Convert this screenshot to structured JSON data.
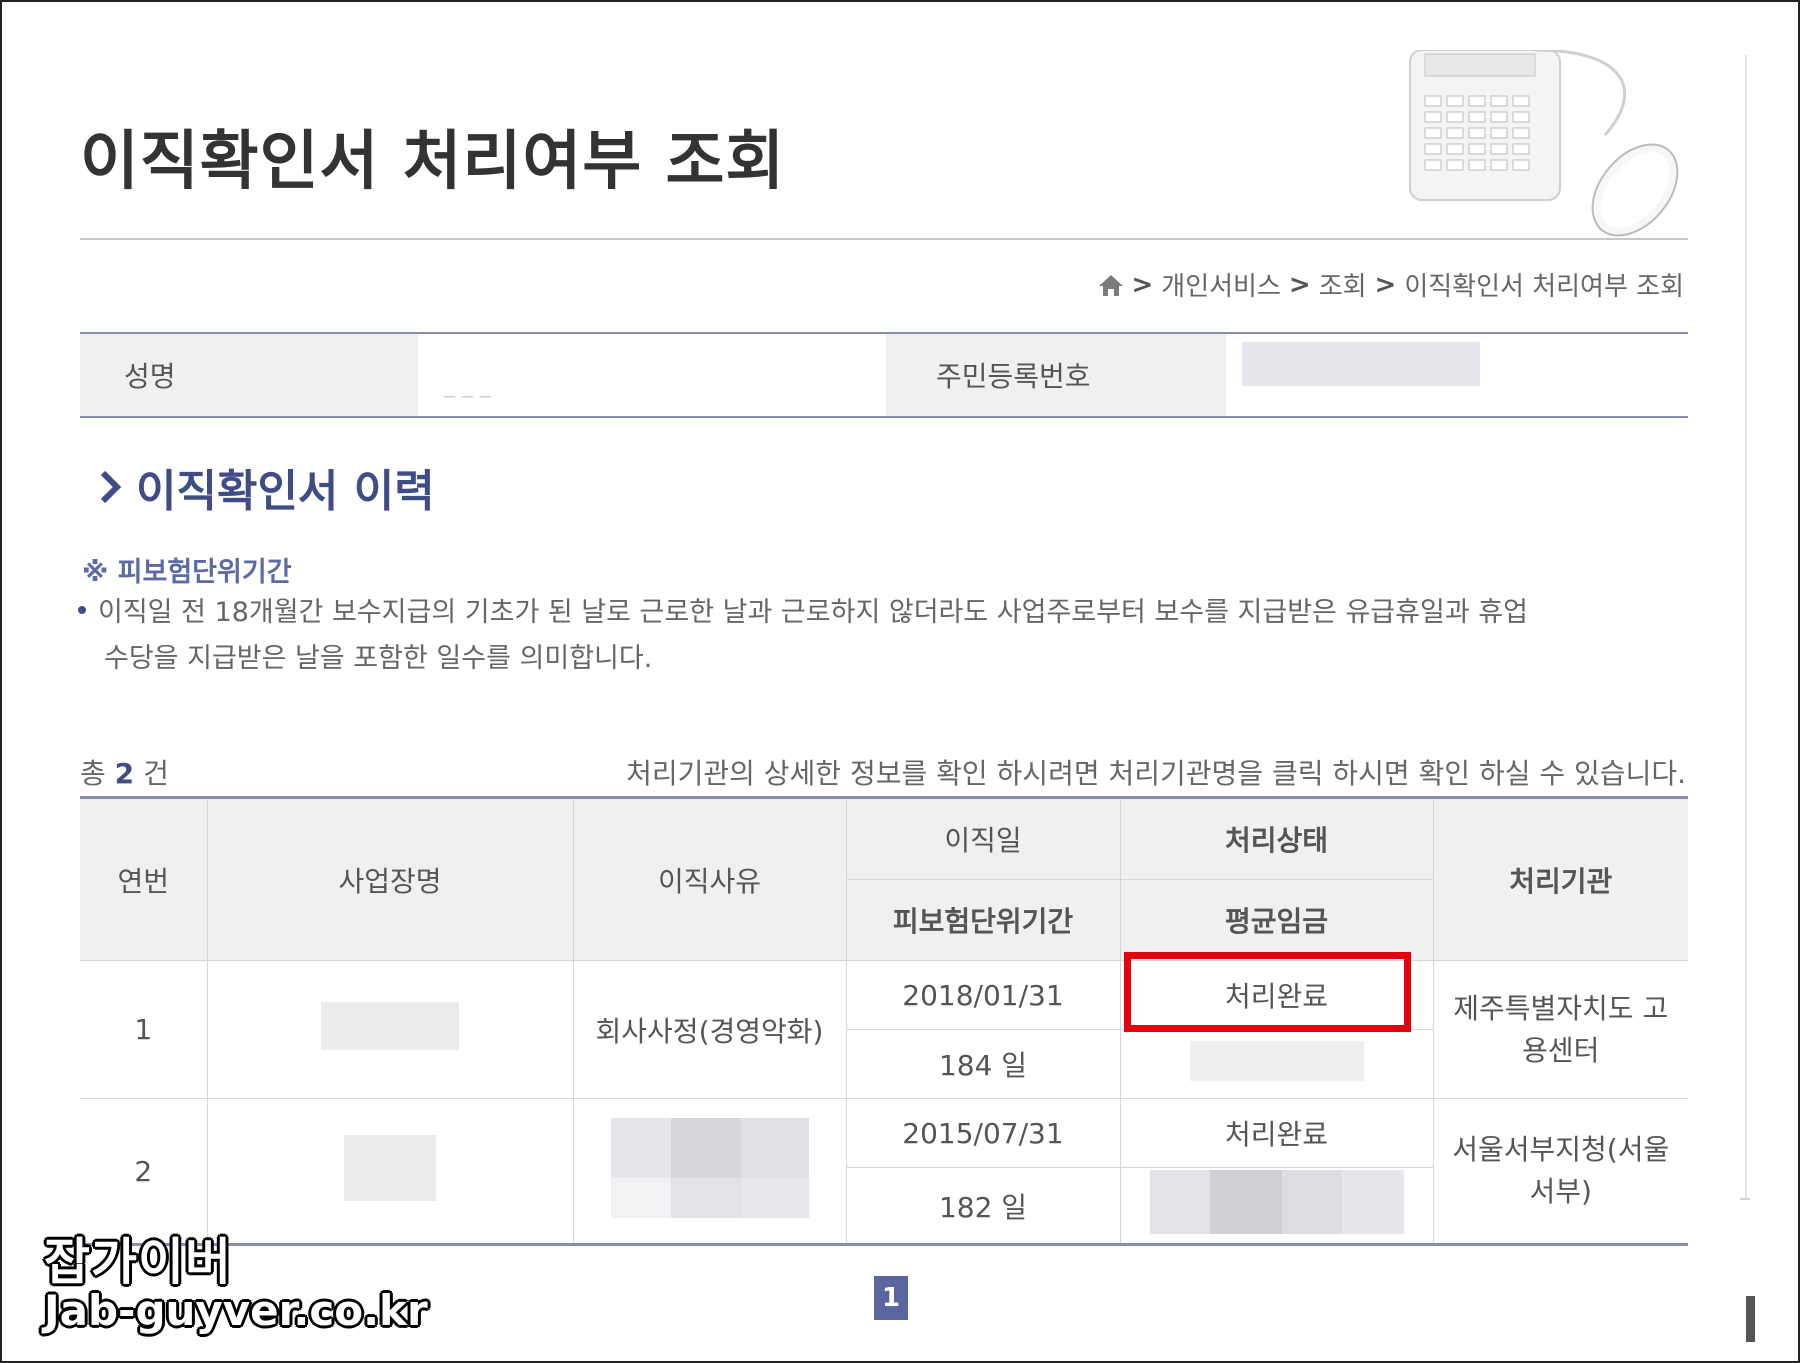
{
  "page": {
    "title": "이직확인서 처리여부 조회"
  },
  "breadcrumb": {
    "home_icon": "home-icon",
    "separator": ">",
    "items": [
      "개인서비스",
      "조회",
      "이직확인서 처리여부 조회"
    ]
  },
  "info": {
    "name_label": "성명",
    "name_value": "_ _ _",
    "rrn_label": "주민등록번호"
  },
  "section": {
    "title": "이직확인서 이력",
    "note_heading": "※ 피보험단위기간",
    "note_line1": "이직일 전 18개월간 보수지급의 기초가 된 날로 근로한 날과 근로하지 않더라도 사업주로부터 보수를 지급받은 유급휴일과 휴업",
    "note_line2": "수당을 지급받은 날을 포함한 일수를 의미합니다."
  },
  "summary": {
    "prefix": "총",
    "count": "2",
    "suffix": "건",
    "help": "처리기관의 상세한 정보를 확인 하시려면 처리기관명을 클릭 하시면 확인 하실 수 있습니다."
  },
  "table": {
    "headers": {
      "seq": "연번",
      "workplace": "사업장명",
      "reason": "이직사유",
      "leave_date": "이직일",
      "status": "처리상태",
      "agency": "처리기관",
      "insured_period": "피보험단위기간",
      "avg_wage": "평균임금"
    },
    "rows": [
      {
        "seq": "1",
        "reason": "회사사정(경영악화)",
        "leave_date": "2018/01/31",
        "status": "처리완료",
        "insured_period": "184 일",
        "agency": "제주특별자치도 고용센터"
      },
      {
        "seq": "2",
        "reason": "",
        "leave_date": "2015/07/31",
        "status": "처리완료",
        "insured_period": "182 일",
        "agency": "서울서부지청(서울서부)"
      }
    ]
  },
  "pagination": {
    "current": "1"
  },
  "watermark": {
    "title": "잡가이버",
    "url": "Jab-guyver.co.kr"
  },
  "colors": {
    "accent": "#3f4c85",
    "border": "#8a8eb2",
    "highlight": "#e3000f",
    "header_bg": "#f0f0f2"
  }
}
